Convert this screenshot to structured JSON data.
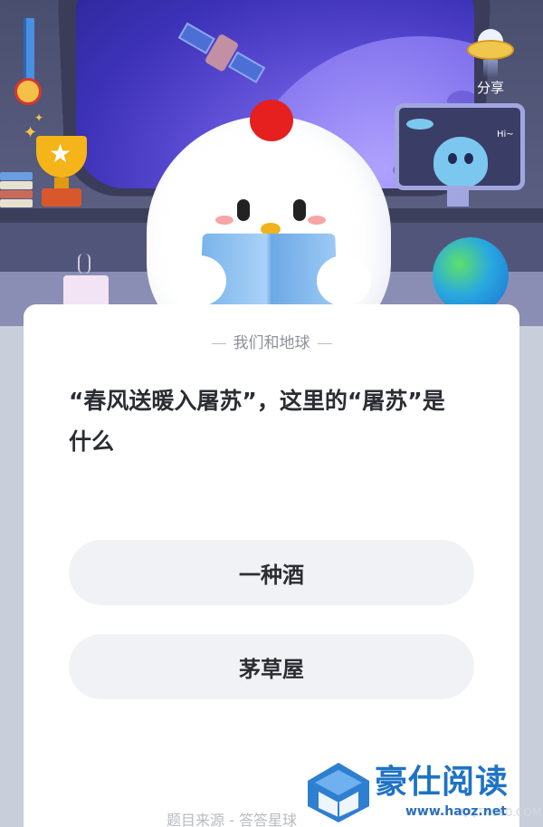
{
  "header": {
    "share_label": "分享",
    "monitor_greeting": "Hi~"
  },
  "quiz": {
    "category": "我们和地球",
    "question": "“春风送暖入屠苏”，这里的“屠苏”是什么",
    "options": [
      {
        "label": "一种酒"
      },
      {
        "label": "茅草屋"
      }
    ],
    "source_text": "题目来源 - 答答星球"
  },
  "watermark": {
    "title": "豪仕阅读",
    "url": "www.haoz.net",
    "ghost": "QQTN360.COM"
  },
  "colors": {
    "card_bg": "#ffffff",
    "option_bg": "#f1f2f5",
    "question_text": "#2a2d33",
    "category_text": "#8e9198",
    "watermark_blue": "#1f73c4"
  },
  "icons": [
    "medal-icon",
    "trophy-icon",
    "ufo-share-icon",
    "monitor-alien-icon",
    "globe-icon",
    "mug-icon",
    "chick-mascot",
    "satellite-icon",
    "book-logo-icon"
  ]
}
